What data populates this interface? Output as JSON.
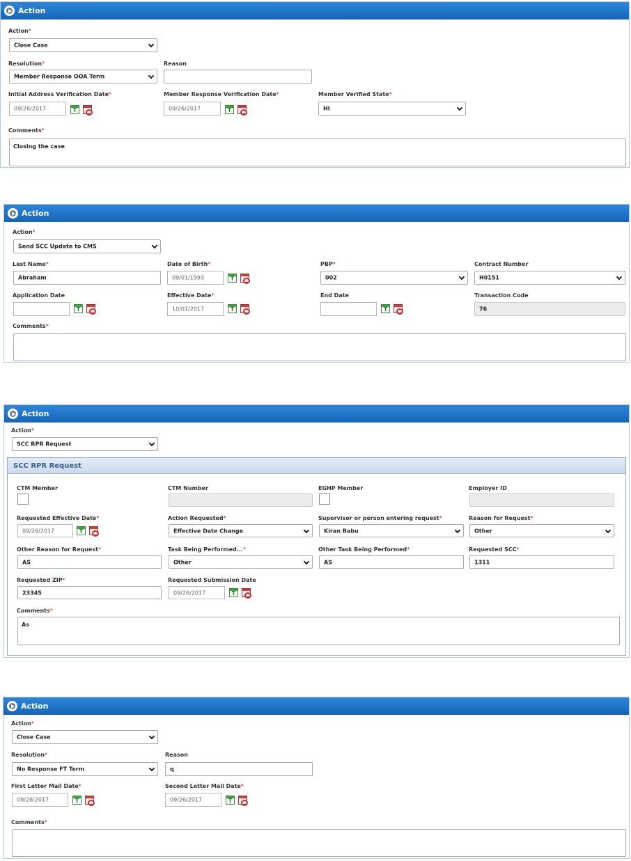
{
  "panels": [
    {
      "header": "Action",
      "action": {
        "label": "Action",
        "value": "Close Case"
      },
      "resolution": {
        "label": "Resolution",
        "value": "Member Response OOA Term"
      },
      "reason": {
        "label": "Reason",
        "value": ""
      },
      "initial_address_date": {
        "label": "Initial Address Verification Date",
        "value": "09/26/2017"
      },
      "member_response_date": {
        "label": "Member Response Verification Date",
        "value": "09/26/2017"
      },
      "member_verified_state": {
        "label": "Member Verified State",
        "value": "HI"
      },
      "comments": {
        "label": "Comments",
        "value": "Closing  the case"
      }
    },
    {
      "header": "Action",
      "action": {
        "label": "Action",
        "value": "Send SCC Update to CMS"
      },
      "last_name": {
        "label": "Last Name",
        "value": "Abraham"
      },
      "date_of_birth": {
        "label": "Date of Birth",
        "value": "09/01/1993"
      },
      "pbp": {
        "label": "PBP",
        "value": "002"
      },
      "contract_number": {
        "label": "Contract Number",
        "value": "H0151"
      },
      "application_date": {
        "label": "Application Date",
        "value": ""
      },
      "effective_date": {
        "label": "Effective Date",
        "value": "10/01/2017"
      },
      "end_date": {
        "label": "End Date",
        "value": ""
      },
      "transaction_code": {
        "label": "Transaction Code",
        "value": "76"
      },
      "comments": {
        "label": "Comments",
        "value": ""
      }
    },
    {
      "header": "Action",
      "action": {
        "label": "Action",
        "value": "SCC RPR Request"
      },
      "section_title": "SCC RPR Request",
      "ctm_member": {
        "label": "CTM Member"
      },
      "ctm_number": {
        "label": "CTM Number",
        "value": ""
      },
      "eghp_member": {
        "label": "EGHP Member"
      },
      "employer_id": {
        "label": "Employer ID",
        "value": ""
      },
      "requested_effective_date": {
        "label": "Requested Effective Date",
        "value": "09/26/2017"
      },
      "action_requested": {
        "label": "Action Requested",
        "value": "Effective Date Change"
      },
      "supervisor": {
        "label": "Supervisor or person entering request",
        "value": "Kiran Babu"
      },
      "reason_for_request": {
        "label": "Reason for Request",
        "value": "Other"
      },
      "other_reason": {
        "label": "Other Reason for Request",
        "value": "AS"
      },
      "task_being_performed": {
        "label": "Task Being Performed...",
        "value": "Other"
      },
      "other_task": {
        "label": "Other Task Being Performed",
        "value": "AS"
      },
      "requested_scc": {
        "label": "Requested SCC",
        "value": "1311"
      },
      "requested_zip": {
        "label": "Requested ZIP",
        "value": "23345"
      },
      "requested_submission_date": {
        "label": "Requested Submission Date",
        "value": "09/26/2017"
      },
      "comments": {
        "label": "Comments",
        "value": "As"
      }
    },
    {
      "header": "Action",
      "action": {
        "label": "Action",
        "value": "Close Case"
      },
      "resolution": {
        "label": "Resolution",
        "value": "No Response FT Term"
      },
      "reason": {
        "label": "Reason",
        "value": "q"
      },
      "first_letter_date": {
        "label": "First Letter Mail Date",
        "value": "09/26/2017"
      },
      "second_letter_date": {
        "label": "Second Letter Mail Date",
        "value": "09/26/2017"
      },
      "comments": {
        "label": "Comments",
        "value": ""
      }
    }
  ],
  "icons": {
    "calendar": "calendar-today-icon",
    "clear": "clear-date-icon",
    "header": "action-arrow-icon"
  },
  "cal_glyph": "T"
}
